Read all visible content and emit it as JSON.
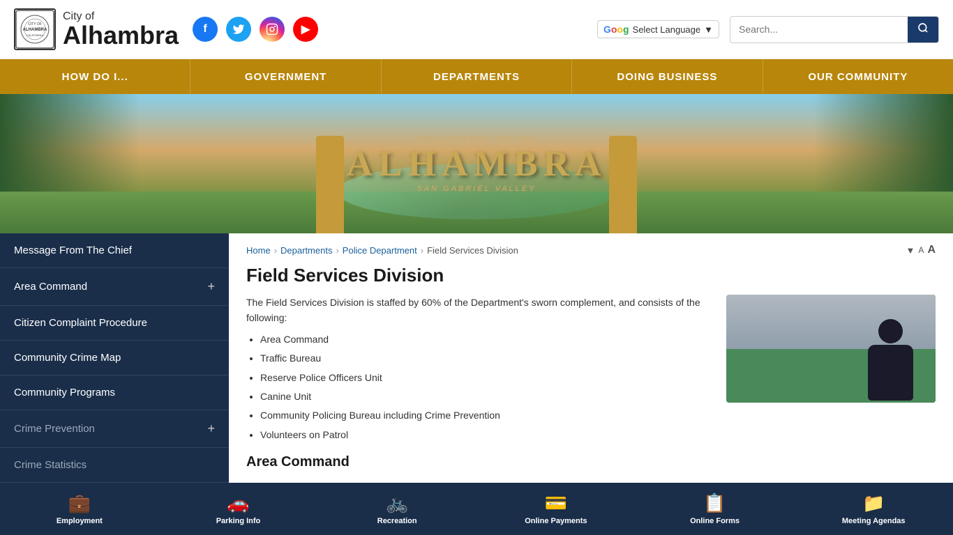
{
  "header": {
    "city_of": "City of",
    "city_name": "Alhambra",
    "social": {
      "facebook_label": "f",
      "twitter_label": "t",
      "instagram_label": "in",
      "youtube_label": "▶"
    },
    "translate_label": "Select Language",
    "search_placeholder": "Search..."
  },
  "nav": {
    "items": [
      {
        "label": "HOW DO I..."
      },
      {
        "label": "GOVERNMENT"
      },
      {
        "label": "DEPARTMENTS"
      },
      {
        "label": "DOING BUSINESS"
      },
      {
        "label": "OUR COMMUNITY"
      }
    ]
  },
  "hero": {
    "gateway_text": "THE GATEWAY TO THE",
    "city_text": "ALHAMBRA",
    "valley_text": "SAN GABRIEL VALLEY"
  },
  "sidebar": {
    "items": [
      {
        "label": "Message From The Chief",
        "has_plus": false,
        "dimmed": false
      },
      {
        "label": "Area Command",
        "has_plus": true,
        "dimmed": false
      },
      {
        "label": "Citizen Complaint Procedure",
        "has_plus": false,
        "dimmed": false
      },
      {
        "label": "Community Crime Map",
        "has_plus": false,
        "dimmed": false
      },
      {
        "label": "Community Programs",
        "has_plus": false,
        "dimmed": false
      },
      {
        "label": "Crime Prevention",
        "has_plus": true,
        "dimmed": true
      },
      {
        "label": "Crime Statistics",
        "has_plus": false,
        "dimmed": true
      }
    ]
  },
  "breadcrumb": {
    "home": "Home",
    "departments": "Departments",
    "police": "Police Department",
    "current": "Field Services Division",
    "font_small": "A",
    "font_large": "A"
  },
  "content": {
    "title": "Field Services Division",
    "intro": "The Field Services Division is staffed by 60% of the Department's sworn complement, and consists of the following:",
    "list_items": [
      "Area Command",
      "Traffic Bureau",
      "Reserve Police Officers Unit",
      "Canine Unit",
      "Community Policing Bureau including Crime Prevention",
      "Volunteers on Patrol"
    ],
    "section_heading": "Area Command"
  },
  "footer": {
    "items": [
      {
        "label": "Employment",
        "icon": "💼"
      },
      {
        "label": "Parking Info",
        "icon": "🚗"
      },
      {
        "label": "Recreation",
        "icon": "🚲"
      },
      {
        "label": "Online Payments",
        "icon": "💳"
      },
      {
        "label": "Online Forms",
        "icon": "📋"
      },
      {
        "label": "Meeting Agendas",
        "icon": "📁"
      }
    ]
  }
}
